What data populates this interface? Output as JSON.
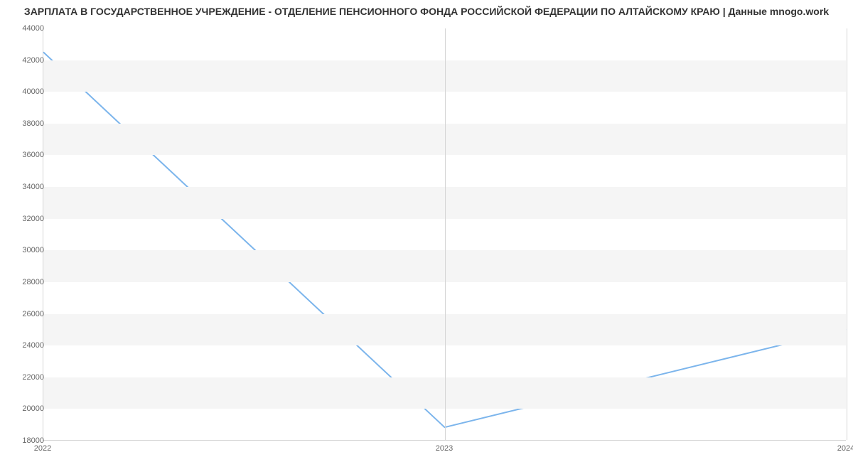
{
  "chart_data": {
    "type": "line",
    "title": "ЗАРПЛАТА В ГОСУДАРСТВЕННОЕ УЧРЕЖДЕНИЕ - ОТДЕЛЕНИЕ ПЕНСИОННОГО ФОНДА РОССИЙСКОЙ ФЕДЕРАЦИИ ПО АЛТАЙСКОМУ КРАЮ | Данные mnogo.work",
    "xlabel": "",
    "ylabel": "",
    "x": [
      "2022",
      "2023",
      "2024"
    ],
    "values": [
      42500,
      18800,
      25000
    ],
    "ylim": [
      18000,
      44000
    ],
    "y_ticks": [
      18000,
      20000,
      22000,
      24000,
      26000,
      28000,
      30000,
      32000,
      34000,
      36000,
      38000,
      40000,
      42000,
      44000
    ],
    "x_ticks": [
      "2022",
      "2023",
      "2024"
    ],
    "line_color": "#7cb5ec",
    "grid": true
  }
}
